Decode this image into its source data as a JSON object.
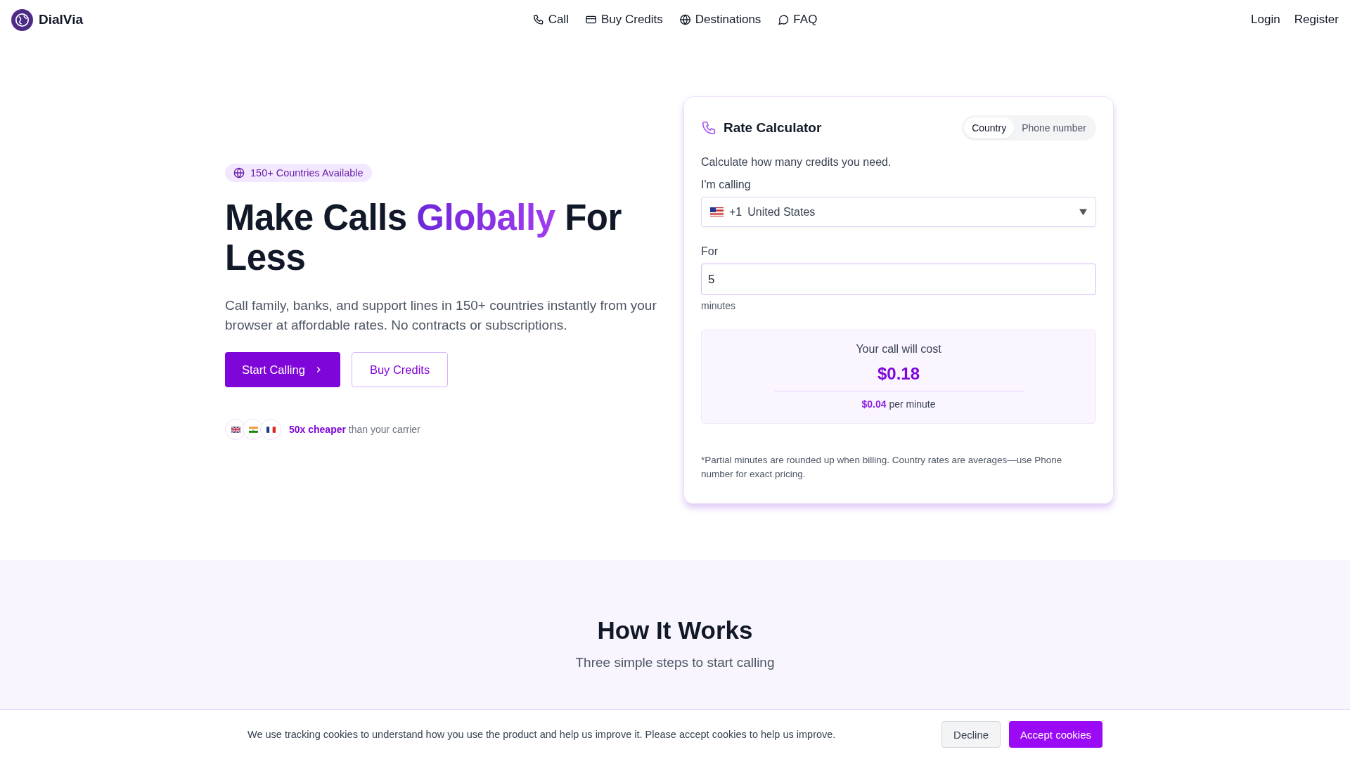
{
  "nav": {
    "brand": "DialVia",
    "links": [
      {
        "label": "Call"
      },
      {
        "label": "Buy Credits"
      },
      {
        "label": "Destinations"
      },
      {
        "label": "FAQ"
      }
    ],
    "auth": [
      "Login",
      "Register"
    ]
  },
  "hero": {
    "badge": "150+ Countries Available",
    "headline": {
      "before": "Make Calls ",
      "highlight": "Globally",
      "after": " For Less"
    },
    "lead": "Call family, banks, and support lines in 150+ countries instantly from your browser at affordable rates. No contracts or subscriptions.",
    "primary_button": "Start Calling",
    "secondary_button": "Buy Credits",
    "proof": "**50x cheaper** than your carrier"
  },
  "calculator": {
    "title": "Rate Calculator",
    "tabs": [
      {
        "label": "Country",
        "selected": true
      },
      {
        "label": "Phone number",
        "selected": false
      }
    ],
    "intro": "Calculate how many credits you need.",
    "calling_label": "I'm calling",
    "country": {
      "code": "+1",
      "name": "United States"
    },
    "for_label": "For",
    "minutes_value": "5",
    "minutes_hint": "minutes",
    "cost_label": "Your call will cost",
    "cost": "$0.18",
    "rate": "$0.04",
    "rate_suffix": "per minute",
    "footnote": "*Partial minutes are rounded up when billing. Country rates are averages—use Phone number for exact pricing."
  },
  "how": {
    "title": "How It Works",
    "subtitle": "Three simple steps to start calling"
  },
  "cookie": {
    "text": "We use tracking cookies to understand how you use the product and help us improve it. Please accept cookies to help us improve.",
    "decline": "Decline",
    "accept": "Accept cookies"
  }
}
